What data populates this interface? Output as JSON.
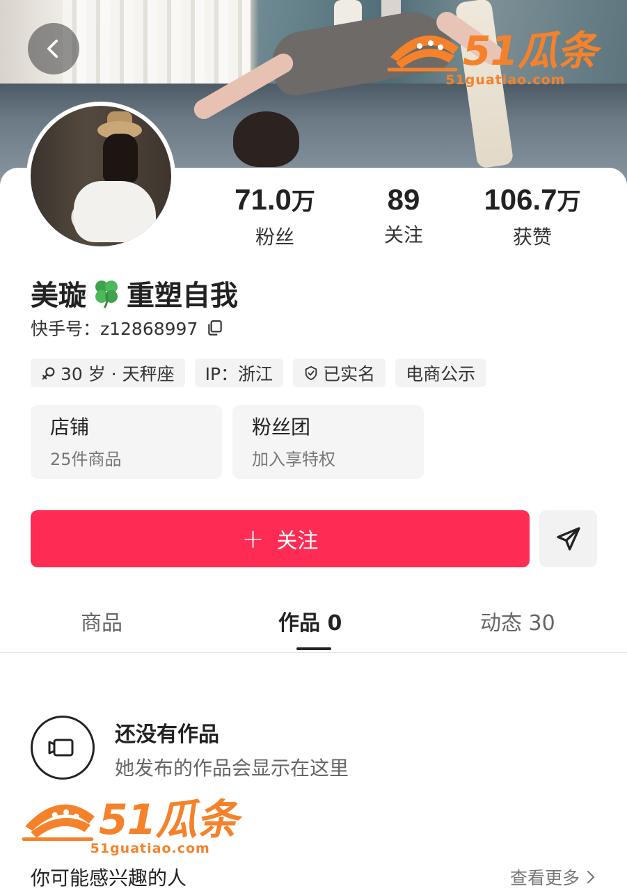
{
  "header": {
    "back_icon": "chevron-left-icon"
  },
  "watermark": {
    "brand": "51瓜条",
    "url": "51guatiao.com",
    "color": "#f5822a"
  },
  "profile": {
    "nickname_prefix": "美璇",
    "nickname_emoji": "four-leaf-clover-icon",
    "nickname_suffix": "重塑自我",
    "uid_label": "快手号：z12868997",
    "stats": [
      {
        "num": "71.0",
        "unit": "万",
        "label": "粉丝"
      },
      {
        "num": "89",
        "unit": "",
        "label": "关注"
      },
      {
        "num": "106.7",
        "unit": "万",
        "label": "获赞"
      }
    ],
    "tags": [
      "30 岁 · 天秤座",
      "IP：浙江",
      "已实名",
      "电商公示"
    ]
  },
  "boxes": [
    {
      "title": "店铺",
      "sub": "25件商品"
    },
    {
      "title": "粉丝团",
      "sub": "加入享特权"
    }
  ],
  "actions": {
    "follow_plus": "+",
    "follow_label": "关注",
    "follow_color": "#fe2c55",
    "share_icon": "send-icon"
  },
  "tabs": [
    {
      "label": "商品"
    },
    {
      "label": "作品 0"
    },
    {
      "label": "动态 30"
    }
  ],
  "empty_state": {
    "title": "还没有作品",
    "subtitle": "她发布的作品会显示在这里"
  },
  "suggest": {
    "title": "你可能感兴趣的人",
    "more": "查看更多"
  }
}
